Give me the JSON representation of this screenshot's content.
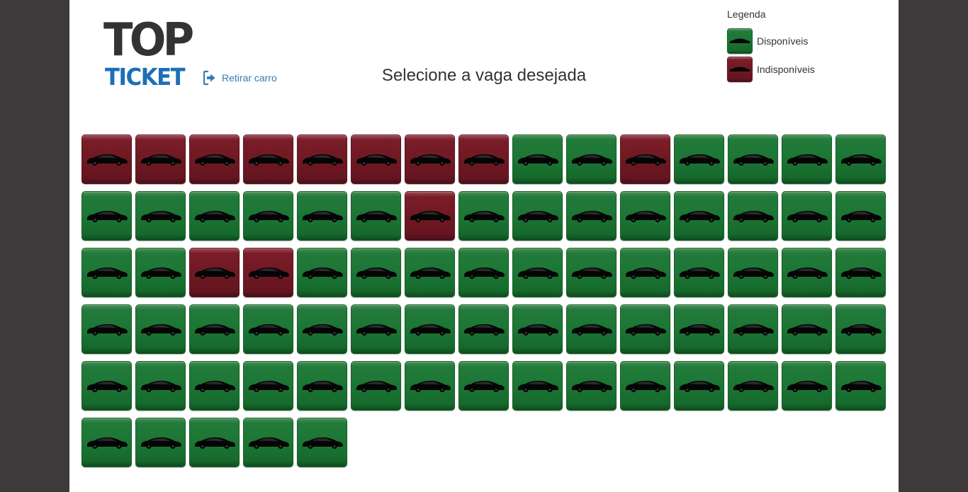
{
  "logo": {
    "line1": "TOP",
    "line2": "TICKET"
  },
  "header": {
    "retirar_label": "Retirar carro",
    "title": "Selecione a vaga desejada"
  },
  "legend": {
    "title": "Legenda",
    "items": [
      {
        "label": "Disponíveis",
        "status": "available",
        "color": "#1b7634"
      },
      {
        "label": "Indisponíveis",
        "status": "unavailable",
        "color": "#701923"
      }
    ]
  },
  "colors": {
    "available": "#1b7634",
    "unavailable": "#701923",
    "link": "#337ab7",
    "logo_blue": "#1c6fba"
  },
  "icons": {
    "retirar": "sign-out-icon",
    "spot": "car-icon"
  },
  "spots": [
    "unavailable",
    "unavailable",
    "unavailable",
    "unavailable",
    "unavailable",
    "unavailable",
    "unavailable",
    "unavailable",
    "available",
    "available",
    "unavailable",
    "available",
    "available",
    "available",
    "available",
    "available",
    "available",
    "available",
    "available",
    "available",
    "available",
    "unavailable",
    "available",
    "available",
    "available",
    "available",
    "available",
    "available",
    "available",
    "available",
    "available",
    "available",
    "unavailable",
    "unavailable",
    "available",
    "available",
    "available",
    "available",
    "available",
    "available",
    "available",
    "available",
    "available",
    "available",
    "available",
    "available",
    "available",
    "available",
    "available",
    "available",
    "available",
    "available",
    "available",
    "available",
    "available",
    "available",
    "available",
    "available",
    "available",
    "available",
    "available",
    "available",
    "available",
    "available",
    "available",
    "available",
    "available",
    "available",
    "available",
    "available",
    "available",
    "available",
    "available",
    "available",
    "available",
    "available",
    "available",
    "available",
    "available",
    "available"
  ]
}
